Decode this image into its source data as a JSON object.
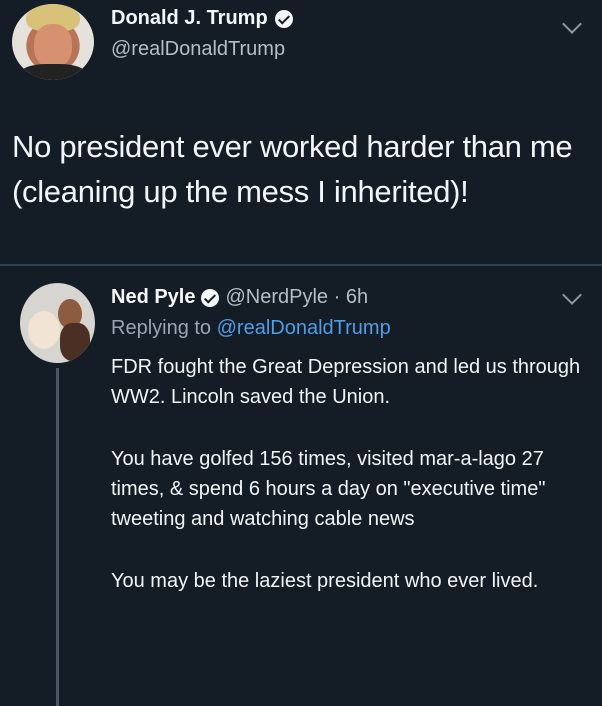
{
  "main_tweet": {
    "display_name": "Donald J. Trump",
    "handle": "@realDonaldTrump",
    "text": "No president ever worked harder than me (cleaning up the mess I inherited)!"
  },
  "reply_tweet": {
    "display_name": "Ned Pyle",
    "meta": "@NerdPyle · 6h",
    "replying_prefix": "Replying to ",
    "replying_to": "@realDonaldTrump",
    "paragraphs": [
      "FDR fought the Great Depression  and led us through WW2. Lincoln saved the Union.",
      "You have golfed 156 times, visited mar-a-lago 27 times, & spend 6 hours a day on \"executive time\" tweeting and watching cable news",
      "You may be the laziest president who ever lived."
    ]
  },
  "icons": {
    "verified": "verified-badge-icon",
    "menu": "chevron-down-icon"
  },
  "colors": {
    "background": "#141d26",
    "link": "#4e9ee8",
    "secondary_text": "#b5bec8"
  }
}
